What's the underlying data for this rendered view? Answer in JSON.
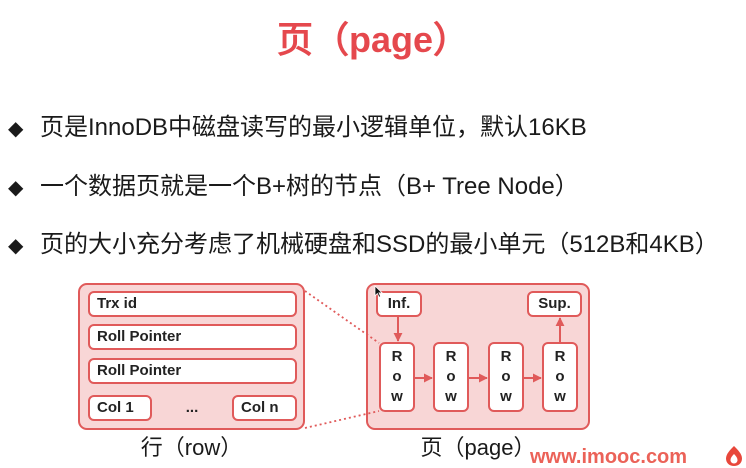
{
  "slide": {
    "title": "页（page）",
    "bullets": [
      {
        "marker": "◆",
        "text": "页是InnoDB中磁盘读写的最小逻辑单位，默认16KB"
      },
      {
        "marker": "◆",
        "text": "一个数据页就是一个B+树的节点（B+ Tree Node）"
      },
      {
        "marker": "◆",
        "text": "页的大小充分考虑了机械硬盘和SSD的最小单元（512B和4KB）"
      }
    ]
  },
  "diagram": {
    "row": {
      "fields": [
        "Trx id",
        "Roll Pointer",
        "Roll Pointer"
      ],
      "columns": [
        "Col 1",
        "...",
        "Col n"
      ],
      "caption": "行（row）"
    },
    "page": {
      "infimum": "Inf.",
      "supremum": "Sup.",
      "rows": [
        "Row",
        "Row",
        "Row",
        "Row"
      ],
      "caption": "页（page）"
    }
  },
  "watermark": {
    "text": "www.imooc.com",
    "logo_icon": "imooc-flame-icon"
  },
  "colors": {
    "title": "#e5484d",
    "accent": "#e05a5a",
    "box_fill": "#f8d6d6",
    "watermark": "#e8473b"
  }
}
